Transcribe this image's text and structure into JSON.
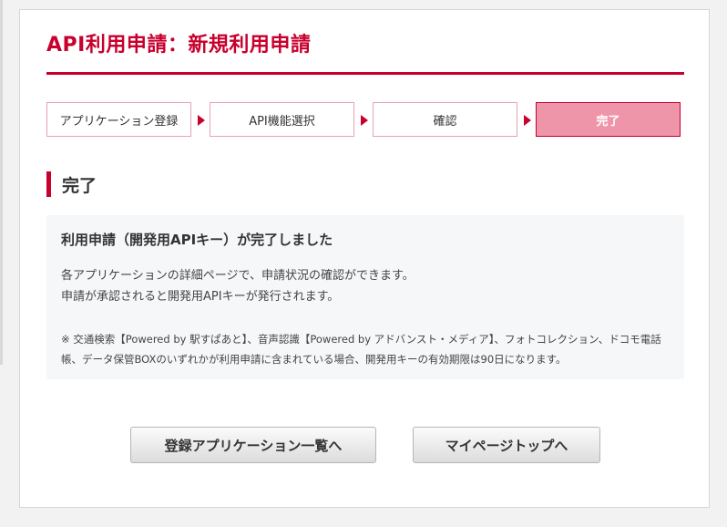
{
  "page": {
    "title": "API利用申請：新規利用申請"
  },
  "steps": [
    {
      "label": "アプリケーション登録",
      "active": false
    },
    {
      "label": "API機能選択",
      "active": false
    },
    {
      "label": "確認",
      "active": false
    },
    {
      "label": "完了",
      "active": true
    }
  ],
  "section": {
    "title": "完了"
  },
  "message": {
    "heading": "利用申請（開発用APIキー）が完了しました",
    "line1": "各アプリケーションの詳細ページで、申請状況の確認ができます。",
    "line2": "申請が承認されると開発用APIキーが発行されます。",
    "note": "※ 交通検索【Powered by 駅すぱあと】、音声認識【Powered by アドバンスト・メディア】、フォトコレクション、ドコモ電話帳、データ保管BOXのいずれかが利用申請に含まれている場合、開発用キーの有効期限は90日になります。"
  },
  "buttons": {
    "app_list": "登録アプリケーション一覧へ",
    "mypage_top": "マイページトップへ"
  },
  "colors": {
    "accent": "#c8002d",
    "active_step": "#ef95a9",
    "message_bg": "#f6f7f9"
  }
}
